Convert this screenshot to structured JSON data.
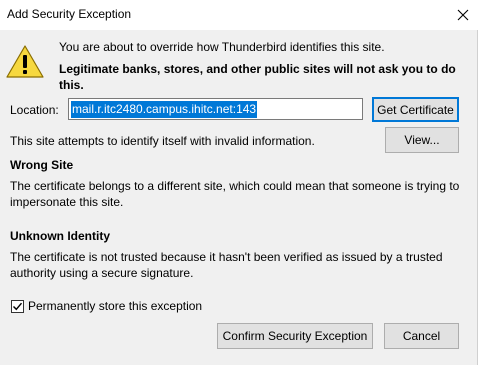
{
  "window": {
    "title": "Add Security Exception"
  },
  "message": {
    "line1": "You are about to override how Thunderbird identifies this site.",
    "line2": "Legitimate banks, stores, and other public sites will not ask you to do this."
  },
  "location": {
    "label": "Location:",
    "value": "mail.r.itc2480.campus.ihitc.net:143"
  },
  "buttons": {
    "get_certificate": "Get Certificate",
    "view": "View...",
    "confirm": "Confirm Security Exception",
    "cancel": "Cancel"
  },
  "status_text": "This site attempts to identify itself with invalid information.",
  "wrong_site": {
    "heading": "Wrong Site",
    "text": "The certificate belongs to a different site, which could mean that someone is trying to impersonate this site."
  },
  "unknown_identity": {
    "heading": "Unknown Identity",
    "text": "The certificate is not trusted because it hasn't been verified as issued by a trusted authority using a secure signature."
  },
  "permanent": {
    "label": "Permanently store this exception",
    "checked": true
  }
}
